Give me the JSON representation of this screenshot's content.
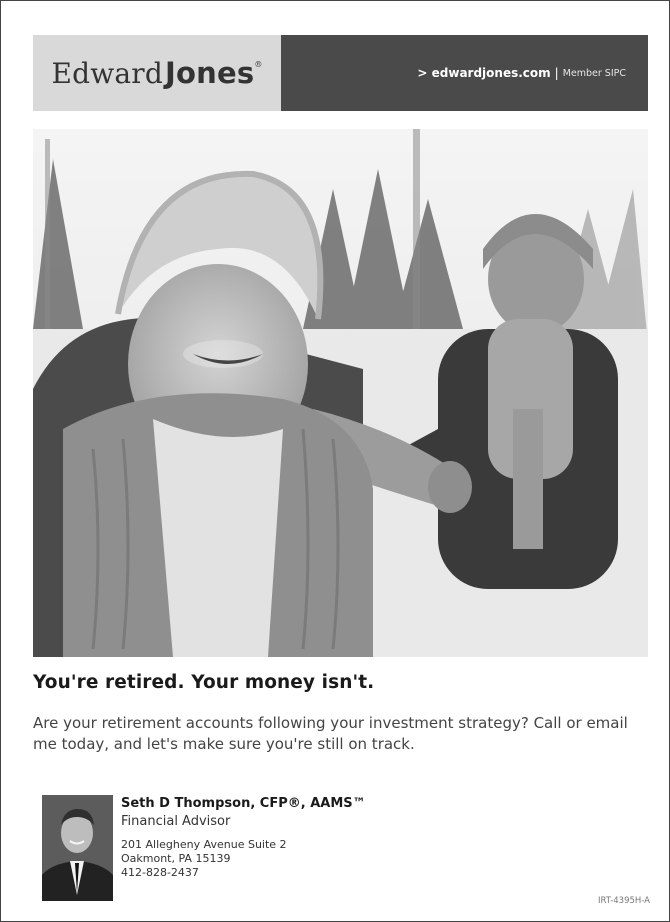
{
  "header": {
    "logo_word1": "Edward",
    "logo_word2": "Jones",
    "logo_mark": "®",
    "site_link": "> edwardjones.com",
    "separator": "|",
    "member": "Member SIPC"
  },
  "content": {
    "headline": "You're retired. Your money isn't.",
    "body": "Are your retirement accounts following your investment strategy? Call or email me today, and let's make sure you're still on track."
  },
  "advisor": {
    "name": "Seth D Thompson, CFP®, AAMS™",
    "title": "Financial Advisor",
    "address_line1": "201 Allegheny Avenue Suite 2",
    "address_line2": "Oakmont, PA 15139",
    "phone": "412-828-2437"
  },
  "footer": {
    "code": "IRT-4395H-A"
  }
}
